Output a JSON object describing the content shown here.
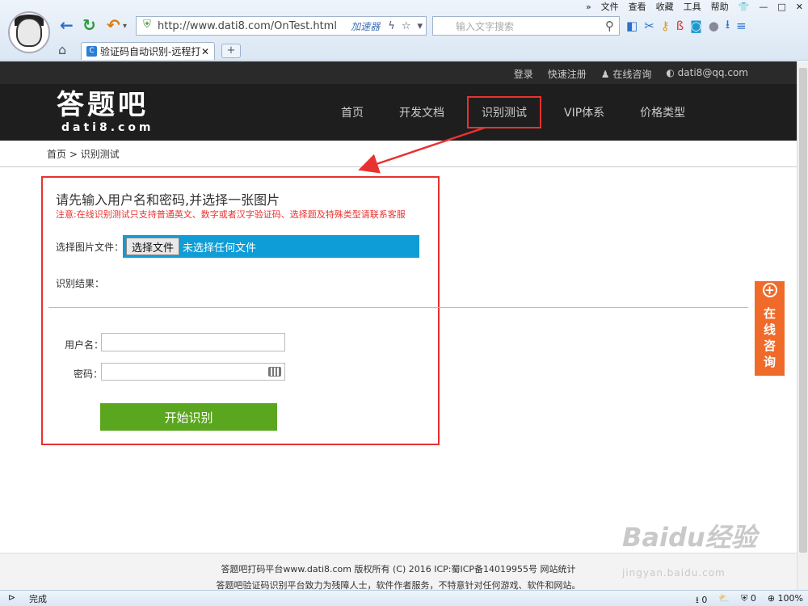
{
  "browser": {
    "menu": [
      "»",
      "文件",
      "查看",
      "收藏",
      "工具",
      "帮助"
    ],
    "url_prefix": "http://",
    "url": "http://www.dati8.com/OnTest.html",
    "accelerator": "加速器",
    "search_placeholder": "输入文字搜索",
    "tab_title": "验证码自动识别-远程打码",
    "new_tab": "+",
    "status_text": "完成",
    "status_count1": "0",
    "status_count2": "0",
    "zoom": "100%"
  },
  "site": {
    "topbar": {
      "login": "登录",
      "register": "快速注册",
      "online": "在线咨询",
      "email": "dati8@qq.com"
    },
    "logo_cn": "答题吧",
    "logo_en": "dati8.com",
    "nav": [
      "首页",
      "开发文档",
      "识别测试",
      "VIP体系",
      "价格类型"
    ],
    "breadcrumb": "首页 > 识别测试"
  },
  "form": {
    "title": "请先输入用户名和密码,并选择一张图片",
    "notice": "注意:在线识别测试只支持普通英文、数字或者汉字验证码、选择题及特殊类型请联系客服",
    "file_label": "选择图片文件：",
    "file_button": "选择文件",
    "file_status": "未选择任何文件",
    "result_label": "识别结果：",
    "user_label": "用户名：",
    "password_label": "密码：",
    "user_value": "",
    "password_value": "",
    "submit": "开始识别"
  },
  "consult_float": "在线咨询",
  "footer": {
    "line1": "答题吧打码平台www.dati8.com 版权所有 (C) 2016 ICP:蜀ICP备14019955号    网站统计",
    "line2": "答题吧验证码识别平台致力为残障人士，软件作者服务，不特意针对任何游戏、软件和网站。"
  },
  "watermark": {
    "main": "Baidu经验",
    "sub": "jingyan.baidu.com"
  },
  "colors": {
    "annotation_red": "#e8322f",
    "file_bar": "#0e9dd6",
    "submit_green": "#5aa61e",
    "consult_orange": "#f06a2a",
    "header_bg": "#1e1e1e"
  }
}
